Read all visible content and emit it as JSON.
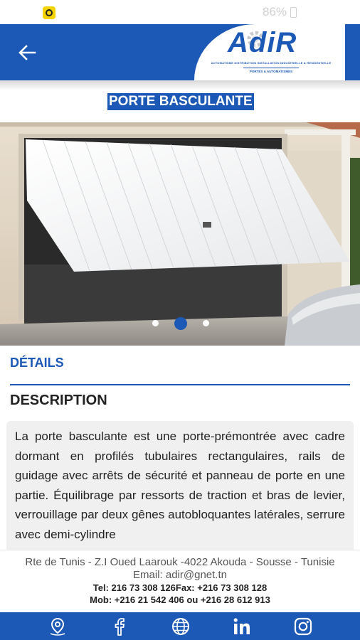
{
  "status_bar": {
    "battery": "86%",
    "app_icon": "notification-app-icon",
    "battery_icon": "battery-charging-icon"
  },
  "header": {
    "back_icon": "arrow-left-icon",
    "logo": {
      "wordmark": "AdiR",
      "tagline": "AUTOMATISME DISTRIBUTION INSTALLATION INDUSTRIELLE & RESIDENTIELLE",
      "subtitle": "PORTES & AUTOMATISMES"
    }
  },
  "page": {
    "title": "PORTE BASCULANTE"
  },
  "carousel": {
    "slide_count": 3,
    "active_index": 1
  },
  "details": {
    "tab_label": "DÉTAILS",
    "section_heading": "DESCRIPTION",
    "description": "La porte basculante est une porte-prémontrée avec cadre dormant en profilés tubulaires rectangulaires, rails de guidage avec arrêts de sécurité et panneau de porte en une partie. Équilibrage par ressorts de traction et bras de levier, verrouillage par deux gênes autobloquantes latérales, serrure avec demi-cylindre"
  },
  "footer": {
    "address": "Rte de Tunis - Z.I Oued Laarouk -4022 Akouda - Sousse - Tunisie",
    "email": "Email: adir@gnet.tn",
    "tel": "Tel: 216 73 308 126Fax: +216 73 308 128",
    "mob": "Mob: +216 21 542 406 ou +216 28 612 913"
  },
  "bottom_nav": {
    "items": [
      "location-pin-icon",
      "facebook-icon",
      "globe-icon",
      "linkedin-icon",
      "instagram-icon"
    ]
  },
  "colors": {
    "brand_blue": "#1c58b5",
    "description_bg": "#f0f0f0"
  }
}
